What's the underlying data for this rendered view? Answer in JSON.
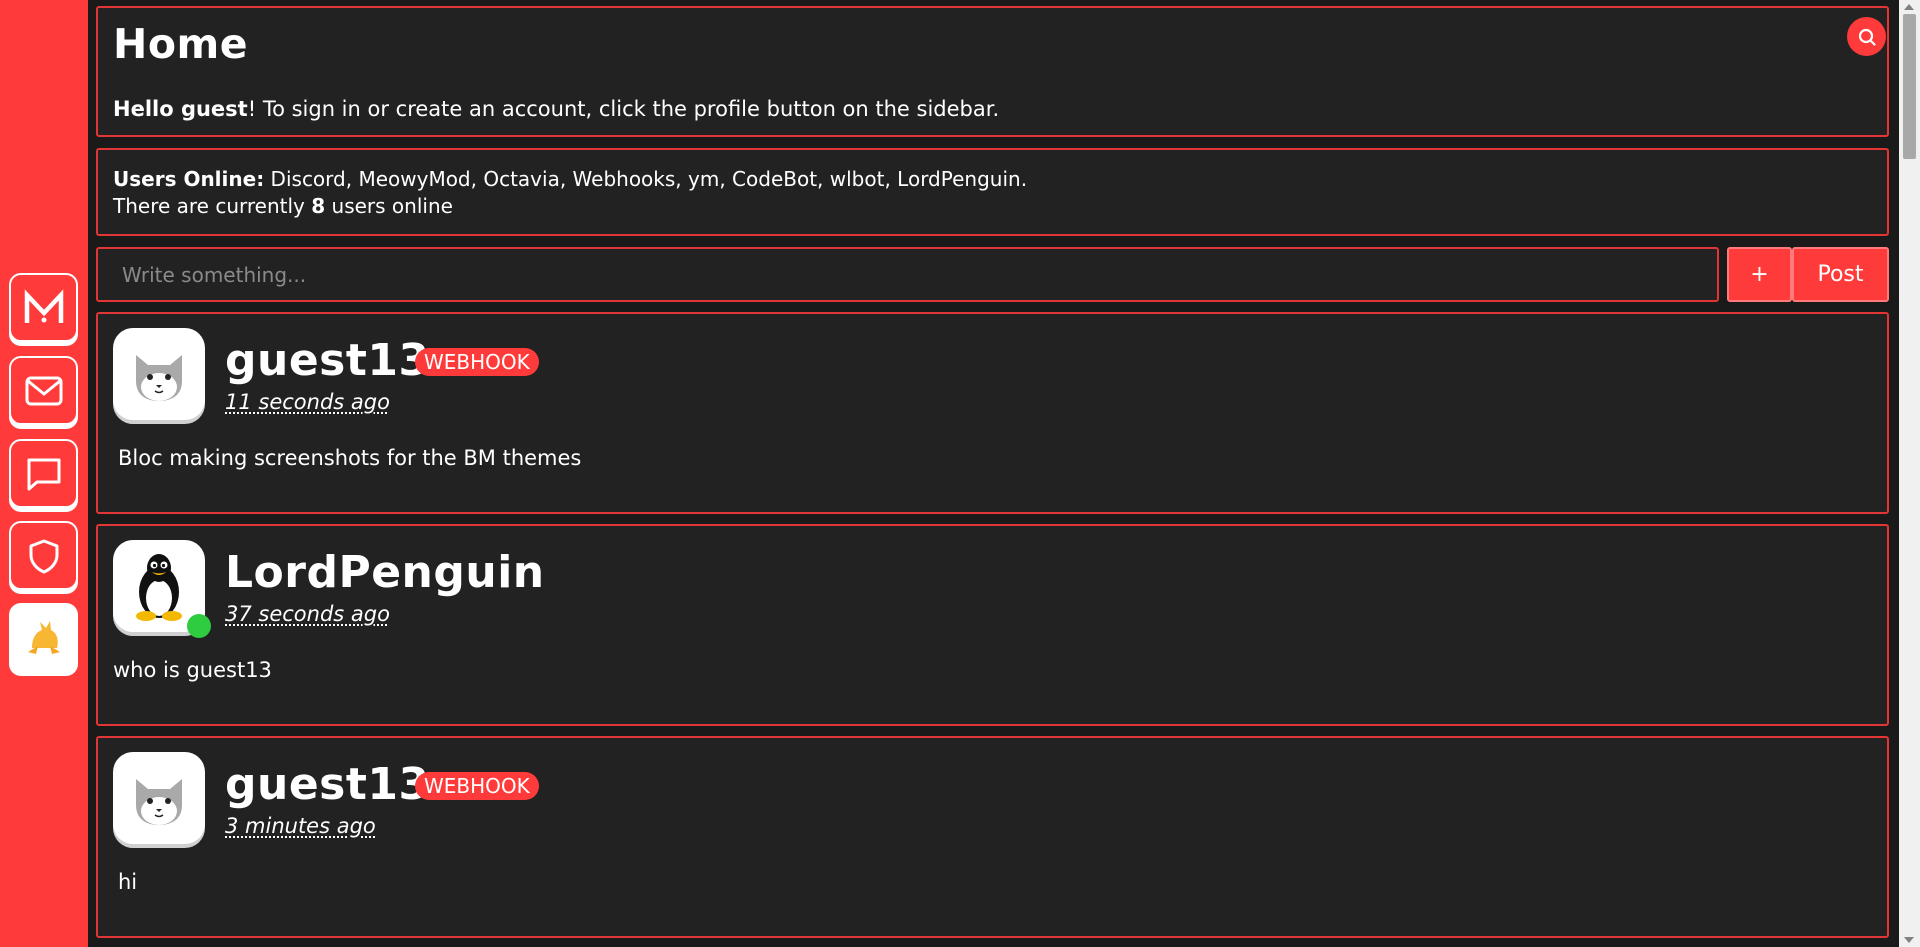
{
  "colors": {
    "accent": "#ff3a3a",
    "panel_bg": "#222222",
    "panel_border": "#e23535",
    "online_dot": "#2ecc40"
  },
  "sidebar": {
    "items": [
      {
        "name": "logo",
        "icon": "meowy-logo-icon"
      },
      {
        "name": "messages",
        "icon": "mail-icon"
      },
      {
        "name": "chats",
        "icon": "chat-bubble-icon"
      },
      {
        "name": "moderation",
        "icon": "shield-icon"
      },
      {
        "name": "profile",
        "icon": "profile-avatar-icon"
      }
    ]
  },
  "header": {
    "title": "Home",
    "greeting_bold": "Hello guest",
    "greeting_rest": "! To sign in or create an account, click the profile button on the sidebar.",
    "search_icon": "search-icon"
  },
  "online": {
    "label": "Users Online:",
    "users": " Discord, MeowyMod, Octavia, Webhooks, ym, CodeBot, wlbot, LordPenguin.",
    "count_prefix": "There are currently ",
    "count": "8",
    "count_suffix": " users online"
  },
  "composer": {
    "placeholder": "Write something...",
    "plus_label": "+",
    "post_label": "Post"
  },
  "posts": [
    {
      "author": "guest13",
      "badge": "WEBHOOK",
      "time": "11 seconds ago",
      "body": "Bloc making screenshots for the BM themes",
      "avatar": "cat-avatar-icon"
    },
    {
      "author": "LordPenguin",
      "badge": "",
      "time": "37 seconds ago",
      "body": "who is guest13",
      "avatar": "penguin-avatar-icon"
    },
    {
      "author": "guest13",
      "badge": "WEBHOOK",
      "time": "3 minutes ago",
      "body": "hi",
      "avatar": "cat-avatar-icon"
    }
  ]
}
